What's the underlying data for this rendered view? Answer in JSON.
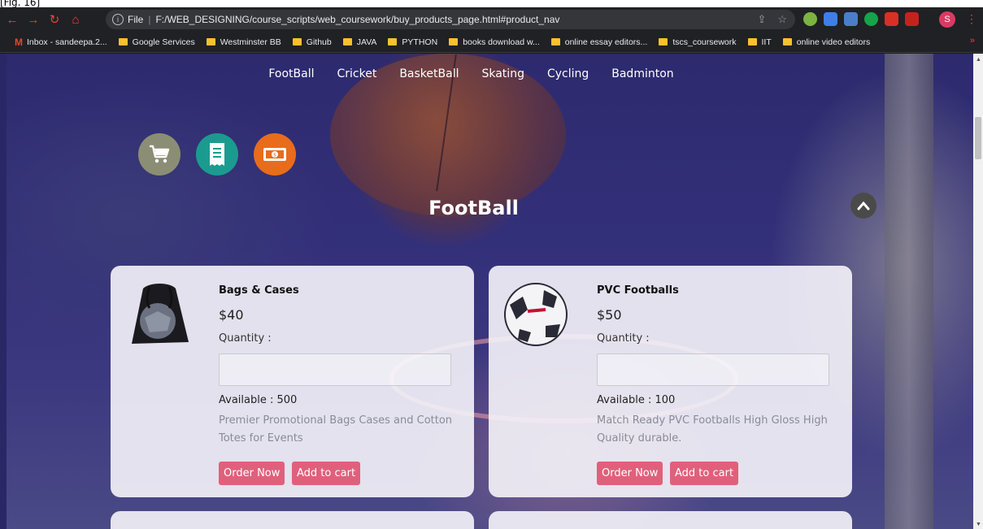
{
  "fragment": "[Fig. 16]",
  "browser": {
    "url_prefix": "File",
    "url": "F:/WEB_DESIGNING/course_scripts/web_coursework/buy_products_page.html#product_nav",
    "profile_initial": "S",
    "bookmarks": [
      {
        "label": "Inbox - sandeepa.2...",
        "type": "gmail"
      },
      {
        "label": "Google Services",
        "type": "folder"
      },
      {
        "label": "Westminster BB",
        "type": "folder"
      },
      {
        "label": "Github",
        "type": "folder"
      },
      {
        "label": "JAVA",
        "type": "folder"
      },
      {
        "label": "PYTHON",
        "type": "folder"
      },
      {
        "label": "books download w...",
        "type": "folder"
      },
      {
        "label": "online essay editors...",
        "type": "folder"
      },
      {
        "label": "tscs_coursework",
        "type": "folder"
      },
      {
        "label": "IIT",
        "type": "folder"
      },
      {
        "label": "online video editors",
        "type": "folder"
      }
    ],
    "bookmarks_more": "»"
  },
  "nav": [
    "FootBall",
    "Cricket",
    "BasketBall",
    "Skating",
    "Cycling",
    "Badminton"
  ],
  "icons": [
    "cart-icon",
    "receipt-icon",
    "money-icon"
  ],
  "section_title": "FootBall",
  "products": [
    {
      "name": "Bags & Cases",
      "price": "$40",
      "quantity_label": "Quantity :",
      "quantity_value": "",
      "available": "Available : 500",
      "description": "Premier Promotional Bags Cases and Cotton Totes for Events",
      "order_label": "Order Now",
      "cart_label": "Add to cart"
    },
    {
      "name": "PVC Footballs",
      "price": "$50",
      "quantity_label": "Quantity :",
      "quantity_value": "",
      "available": "Available : 100",
      "description": "Match Ready PVC Footballs High Gloss High Quality durable.",
      "order_label": "Order Now",
      "cart_label": "Add to cart"
    }
  ],
  "colors": {
    "button": "#e0607c",
    "cart_circle": "#8b8e74",
    "receipt_circle": "#1b9b8f",
    "money_circle": "#e86c1c"
  }
}
